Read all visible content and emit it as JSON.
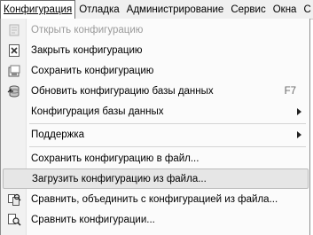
{
  "menubar": {
    "items": [
      {
        "label": "Конфигурация",
        "active": true
      },
      {
        "label": "Отладка"
      },
      {
        "label": "Администрирование"
      },
      {
        "label": "Сервис"
      },
      {
        "label": "Окна"
      },
      {
        "label": "С"
      }
    ]
  },
  "dropdown": {
    "items": [
      {
        "label": "Открыть конфигурацию",
        "icon": "open-config-icon",
        "disabled": true
      },
      {
        "label": "Закрыть конфигурацию",
        "icon": "close-config-icon"
      },
      {
        "label": "Сохранить конфигурацию",
        "icon": "save-config-icon"
      },
      {
        "label": "Обновить конфигурацию базы данных",
        "icon": "database-update-icon",
        "shortcut": "F7"
      },
      {
        "label": "Конфигурация базы данных",
        "submenu": true
      },
      {
        "label": "Поддержка",
        "submenu": true
      },
      {
        "label": "Сохранить конфигурацию в файл..."
      },
      {
        "label": "Загрузить конфигурацию из файла...",
        "highlighted": true
      },
      {
        "label": "Сравнить, объединить с конфигурацией из файла...",
        "icon": "compare-merge-icon"
      },
      {
        "label": "Сравнить конфигурации...",
        "icon": "compare-icon"
      }
    ]
  }
}
